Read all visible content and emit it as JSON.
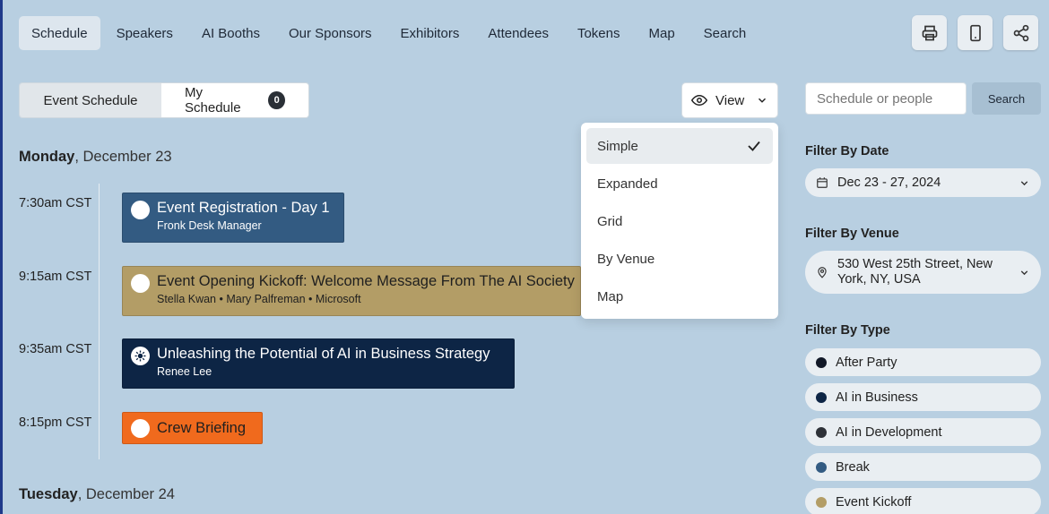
{
  "nav": {
    "tabs": [
      {
        "label": "Schedule",
        "active": true
      },
      {
        "label": "Speakers"
      },
      {
        "label": "AI Booths"
      },
      {
        "label": "Our Sponsors"
      },
      {
        "label": "Exhibitors"
      },
      {
        "label": "Attendees"
      },
      {
        "label": "Tokens"
      },
      {
        "label": "Map"
      },
      {
        "label": "Search"
      }
    ],
    "icons": [
      "printer-icon",
      "mobile-icon",
      "share-icon"
    ]
  },
  "toggle": {
    "event_schedule": "Event Schedule",
    "my_schedule": "My Schedule",
    "my_schedule_count": "0"
  },
  "view": {
    "label": "View",
    "options": [
      "Simple",
      "Expanded",
      "Grid",
      "By Venue",
      "Map"
    ],
    "selected": "Simple"
  },
  "days": [
    {
      "weekday": "Monday",
      "date": ", December 23",
      "events": [
        {
          "time": "7:30am CST",
          "title": "Event Registration - Day 1",
          "sub": "Fronk Desk Manager",
          "color": "#335b82"
        },
        {
          "time": "9:15am CST",
          "title": "Event Opening Kickoff: Welcome Message From The AI Society",
          "sub": "Stella Kwan • Mary Palfreman • Microsoft",
          "color": "#b39d66"
        },
        {
          "time": "9:35am CST",
          "title": "Unleashing the Potential of AI in Business Strategy",
          "sub": "Renee Lee",
          "color": "#0d2545"
        },
        {
          "time": "8:15pm CST",
          "title": "Crew Briefing",
          "sub": "",
          "color": "#f06a1d"
        }
      ]
    },
    {
      "weekday": "Tuesday",
      "date": ", December 24"
    }
  ],
  "sidebar": {
    "search_placeholder": "Schedule or people",
    "search_button": "Search",
    "filter_date_label": "Filter By Date",
    "filter_date_value": "Dec 23 - 27, 2024",
    "filter_venue_label": "Filter By Venue",
    "filter_venue_value_1": "530 West 25th Street, New",
    "filter_venue_value_2": "York, NY, USA",
    "filter_type_label": "Filter By Type",
    "types": [
      {
        "label": "After Party",
        "color": "#111827"
      },
      {
        "label": "AI in Business",
        "color": "#0d2545"
      },
      {
        "label": "AI in Development",
        "color": "#2d3138"
      },
      {
        "label": "Break",
        "color": "#335b82"
      },
      {
        "label": "Event Kickoff",
        "color": "#b39d66"
      }
    ]
  }
}
